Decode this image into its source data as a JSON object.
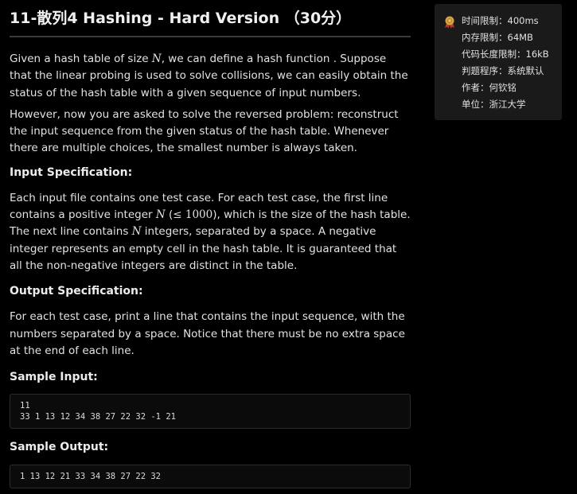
{
  "problem": {
    "title": "11-散列4 Hashing - Hard Version （30分）",
    "description": {
      "p1_a": "Given a hash table of size ",
      "p1_N": "N",
      "p1_b": ", we can define a hash function . Suppose that the linear probing is used to solve collisions, we can easily obtain the status of the hash table with a given sequence of input numbers.",
      "p2": "However, now you are asked to solve the reversed problem: reconstruct the input sequence from the given status of the hash table. Whenever there are multiple choices, the smallest number is always taken."
    },
    "input_spec": {
      "heading": "Input Specification:",
      "a": "Each input file contains one test case. For each test case, the first line contains a positive integer ",
      "N1": "N",
      "b": " (",
      "le": "≤",
      "num": " 1000",
      "c": "), which is the size of the hash table. The next line contains ",
      "N2": "N",
      "d": " integers, separated by a space. A negative integer represents an empty cell in the hash table. It is guaranteed that all the non-negative integers are distinct in the table."
    },
    "output_spec": {
      "heading": "Output Specification:",
      "text": "For each test case, print a line that contains the input sequence, with the numbers separated by a space. Notice that there must be no extra space at the end of each line."
    },
    "sample_input": {
      "heading": "Sample Input:",
      "lines": [
        "11",
        "33 1 13 12 34 38 27 22 32 -1 21"
      ]
    },
    "sample_output": {
      "heading": "Sample Output:",
      "lines": [
        "1 13 12 21 33 34 38 27 22 32"
      ]
    }
  },
  "side_panel": {
    "icon": "award-badge-icon",
    "rows": [
      "时间限制：400ms",
      "内存限制：64MB",
      "代码长度限制：16kB",
      "判题程序：系统默认",
      "作者：何钦铭",
      "单位：浙江大学"
    ]
  },
  "colors": {
    "background": "#000000",
    "panel": "#1a1a1a",
    "badge_gold": "#d9a441",
    "badge_red": "#c0392b"
  }
}
